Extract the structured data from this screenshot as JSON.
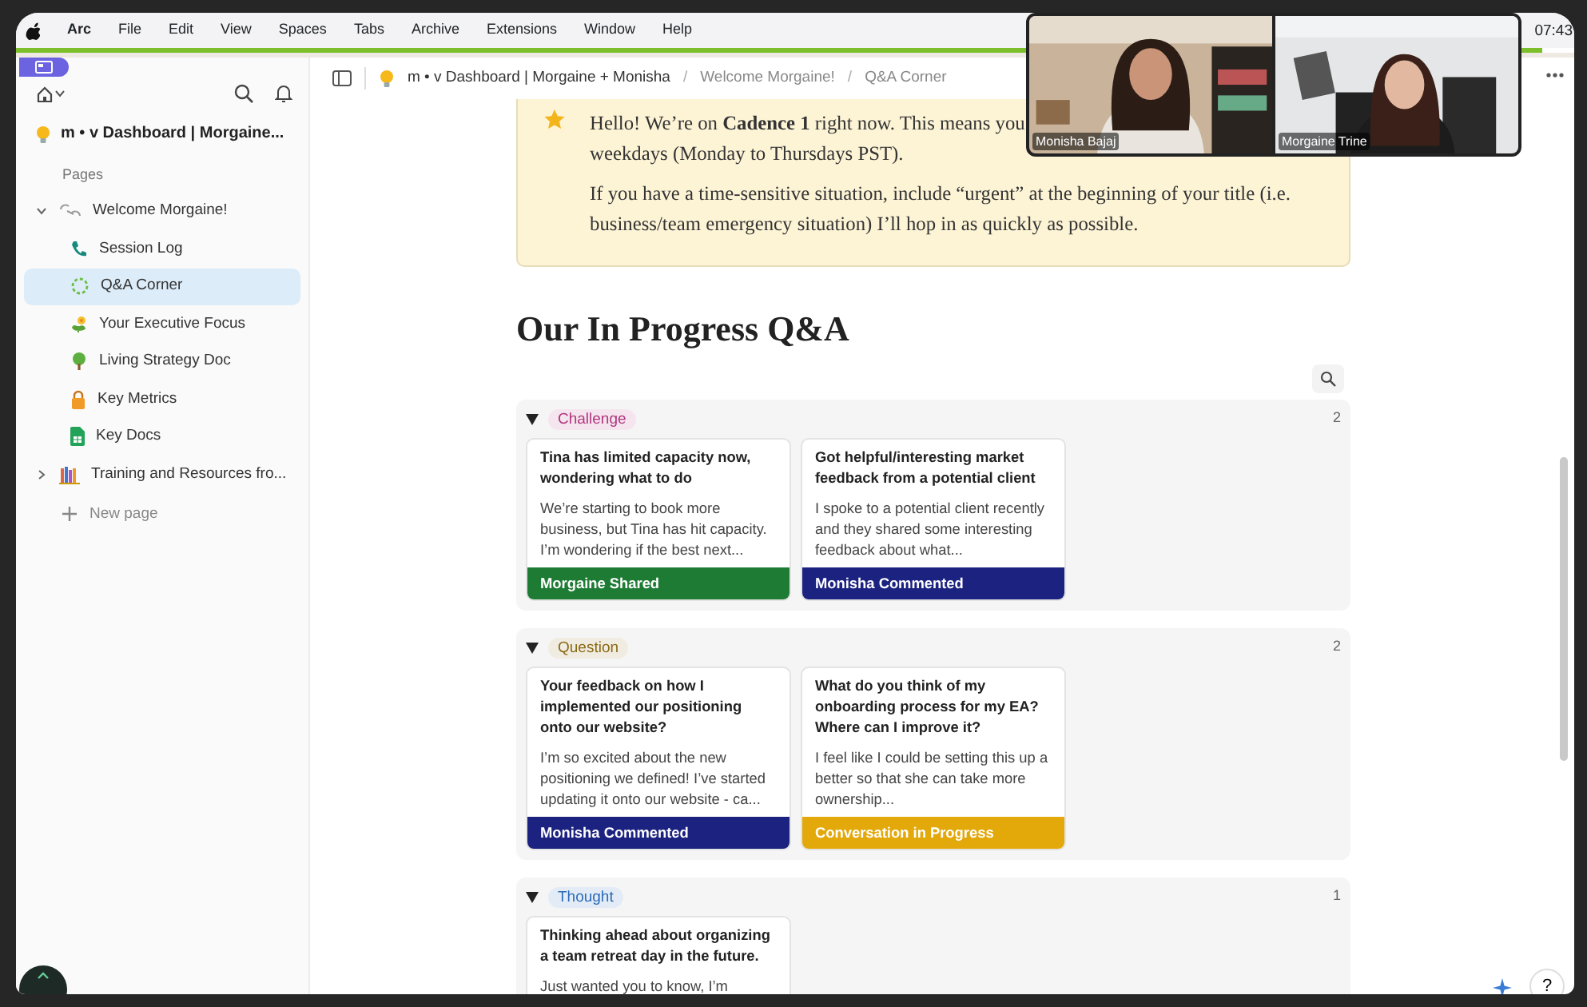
{
  "menubar": {
    "items": [
      {
        "label": "Arc",
        "kind": "app"
      },
      {
        "label": "File",
        "kind": "menu"
      },
      {
        "label": "Edit",
        "kind": "menu"
      },
      {
        "label": "View",
        "kind": "menu"
      },
      {
        "label": "Spaces",
        "kind": "menu"
      },
      {
        "label": "Tabs",
        "kind": "menu"
      },
      {
        "label": "Archive",
        "kind": "menu"
      },
      {
        "label": "Extensions",
        "kind": "menu"
      },
      {
        "label": "Window",
        "kind": "menu"
      },
      {
        "label": "Help",
        "kind": "menu"
      }
    ],
    "clock": "07:43"
  },
  "sidebar": {
    "workspace": "m • v Dashboard | Morgaine...",
    "section": "Pages",
    "items": [
      {
        "label": "Welcome Morgaine!",
        "selected": false,
        "expanded": true,
        "children": [
          {
            "label": "Session Log",
            "selected": false
          },
          {
            "label": "Q&A Corner",
            "selected": true
          },
          {
            "label": "Your Executive Focus",
            "selected": false
          },
          {
            "label": "Living Strategy Doc",
            "selected": false
          },
          {
            "label": "Key Metrics",
            "selected": false
          },
          {
            "label": "Key Docs",
            "selected": false
          }
        ]
      },
      {
        "label": "Training and Resources fro...",
        "selected": false,
        "expanded": false
      }
    ],
    "new_page": "New page"
  },
  "breadcrumb": [
    {
      "label": "m • v Dashboard | Morgaine + Monisha"
    },
    {
      "separator": "/",
      "label": "Welcome Morgaine!"
    },
    {
      "separator": "/",
      "label": "Q&A Corner"
    }
  ],
  "callout": {
    "paragraphs": [
      [
        "Hello! We’re on **Cadence 1** right now. This means you",
        "weekdays (Monday to Thursdays PST)."
      ],
      [
        "If you have a time-sensitive situation,  include “urgent” at the beginning of your title (i.e.",
        "business/team emergency situation) I’ll hop in as quickly as possible."
      ]
    ]
  },
  "heading": "Our In Progress Q&A",
  "groups": [
    {
      "tag": "Challenge",
      "color": "#b0357f",
      "count": "2",
      "expanded": true,
      "cards": [
        {
          "title": "Tina has limited capacity now, wondering what to do",
          "body": "We’re starting to book more business, but Tina has hit capacity. I’m wondering if the best next...",
          "status": "Morgaine Shared",
          "color": "#1e7b34"
        },
        {
          "title": "Got helpful/interesting market feedback from a potential client",
          "body": "I spoke to a potential client recently and they shared some interesting feedback about what...",
          "status": "Monisha Commented",
          "color": "#1c2280"
        }
      ]
    },
    {
      "tag": "Question",
      "color": "#8a6a16",
      "count": "2",
      "expanded": true,
      "cards": [
        {
          "title": "Your feedback on how I implemented our positioning onto our website?",
          "body": "I’m so excited about the new positioning we defined! I’ve started updating it onto our website - ca...",
          "status": "Monisha Commented",
          "color": "#1c2280"
        },
        {
          "title": "What do you think of my onboarding process for my EA? Where can I improve it?",
          "body": "I feel like I could be setting this up a better so that she can take more ownership...",
          "status": "Conversation in Progress",
          "color": "#e3a80a"
        }
      ]
    },
    {
      "tag": "Thought",
      "color": "#2a6cb8",
      "count": "1",
      "expanded": true,
      "cards": [
        {
          "title": "Thinking ahead about organizing a team retreat day in the future.",
          "body": "Just wanted you to know, I’m"
        }
      ]
    }
  ],
  "call": {
    "participants": [
      {
        "name": "Monisha Bajaj",
        "kind": "picture"
      },
      {
        "name": "Morgaine Trine",
        "kind": "picture"
      }
    ]
  },
  "help": "?"
}
